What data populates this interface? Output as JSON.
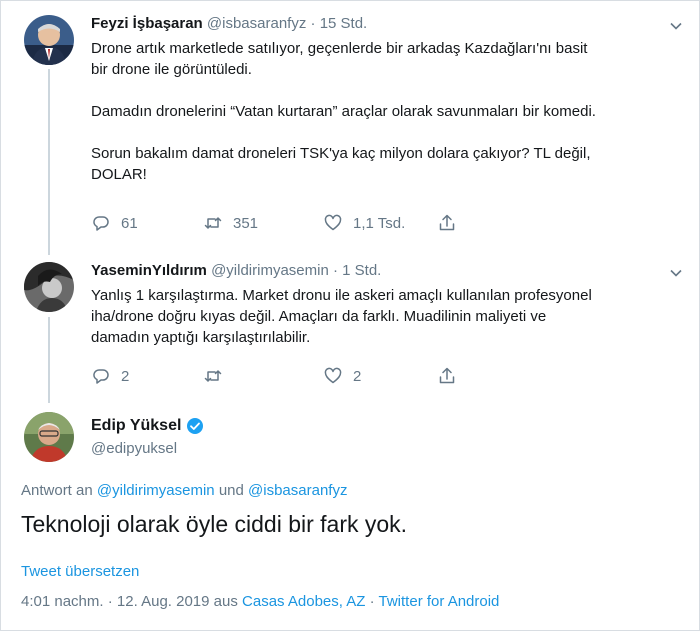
{
  "tweets": [
    {
      "name": "Feyzi İşbaşaran",
      "handle": "@isbasaranfyz",
      "separator": "·",
      "time": "15 Std.",
      "lines": [
        "Drone artık marketlede satılıyor, geçenlerde bir arkadaş Kazdağları'nı basit",
        "bir drone ile görüntüledi.",
        "",
        "Damadın dronelerini “Vatan kurtaran”  araçlar olarak savunmaları bir komedi.",
        "",
        "Sorun bakalım damat droneleri TSK'ya kaç milyon dolara çakıyor? TL değil,",
        "DOLAR!"
      ],
      "replies": "61",
      "retweets": "351",
      "likes": "1,1 Tsd."
    },
    {
      "name": "YaseminYıldırım",
      "handle": "@yildirimyasemin",
      "separator": "·",
      "time": "1 Std.",
      "lines": [
        "Yanlış 1 karşılaştırma. Market dronu ile askeri amaçlı kullanılan profesyonel",
        "iha/drone doğru kıyas değil. Amaçları da farklı. Muadilinin maliyeti ve",
        "damadın yaptığı karşılaştırılabilir."
      ],
      "replies": "2",
      "retweets": "",
      "likes": "2"
    }
  ],
  "main": {
    "name": "Edip Yüksel",
    "handle": "@edipyuksel",
    "reply_prefix": "Antwort an",
    "reply_user1": "@yildirimyasemin",
    "reply_and": "und",
    "reply_user2": "@isbasaranfyz",
    "text": "Teknoloji olarak öyle ciddi bir fark yok.",
    "translate": "Tweet übersetzen",
    "time": "4:01 nachm.",
    "meta_sep": "·",
    "date": "12. Aug. 2019",
    "from": "aus",
    "location": "Casas Adobes, AZ",
    "client": "Twitter for Android"
  },
  "icons": {
    "reply": "reply-icon",
    "retweet": "retweet-icon",
    "like": "heart-icon",
    "share": "share-icon",
    "caret": "chevron-down-icon",
    "verified": "verified-badge-icon"
  },
  "colors": {
    "text": "#14171a",
    "secondary": "#657786",
    "link": "#1b95e0",
    "thread": "#ccd6dd"
  }
}
